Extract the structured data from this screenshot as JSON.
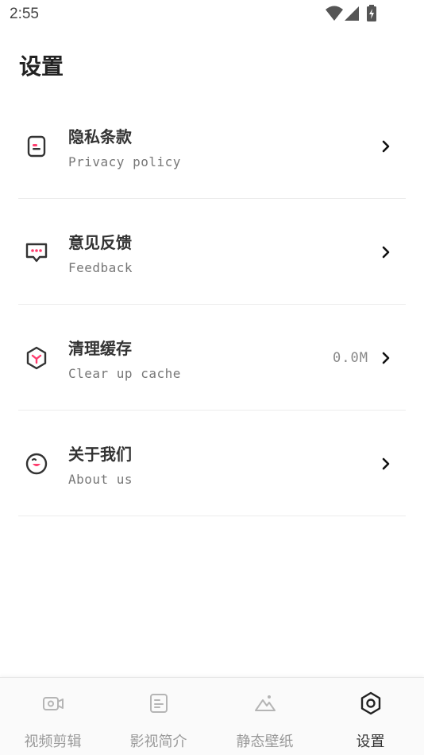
{
  "status_bar": {
    "time": "2:55",
    "icons": [
      "wifi-icon",
      "cell-signal-icon",
      "battery-charging-icon"
    ]
  },
  "page": {
    "title": "设置"
  },
  "settings": {
    "items": [
      {
        "title": "隐私条款",
        "subtitle": "Privacy policy",
        "value": "",
        "icon": "privacy-document-icon"
      },
      {
        "title": "意见反馈",
        "subtitle": "Feedback",
        "value": "",
        "icon": "feedback-chat-icon"
      },
      {
        "title": "清理缓存",
        "subtitle": "Clear up cache",
        "value": "0.0M",
        "icon": "clear-cache-hexagon-icon"
      },
      {
        "title": "关于我们",
        "subtitle": "About us",
        "value": "",
        "icon": "about-smiley-icon"
      }
    ]
  },
  "bottom_nav": {
    "active_index": 3,
    "tabs": [
      {
        "label": "视频剪辑",
        "icon": "video-edit-icon"
      },
      {
        "label": "影视简介",
        "icon": "film-intro-icon"
      },
      {
        "label": "静态壁纸",
        "icon": "wallpaper-icon"
      },
      {
        "label": "设置",
        "icon": "settings-hexagon-icon"
      }
    ]
  },
  "colors": {
    "accent": "#ff3d6e",
    "icon_dark": "#333333",
    "nav_inactive": "#9a9a9a",
    "divider": "#ececec"
  }
}
